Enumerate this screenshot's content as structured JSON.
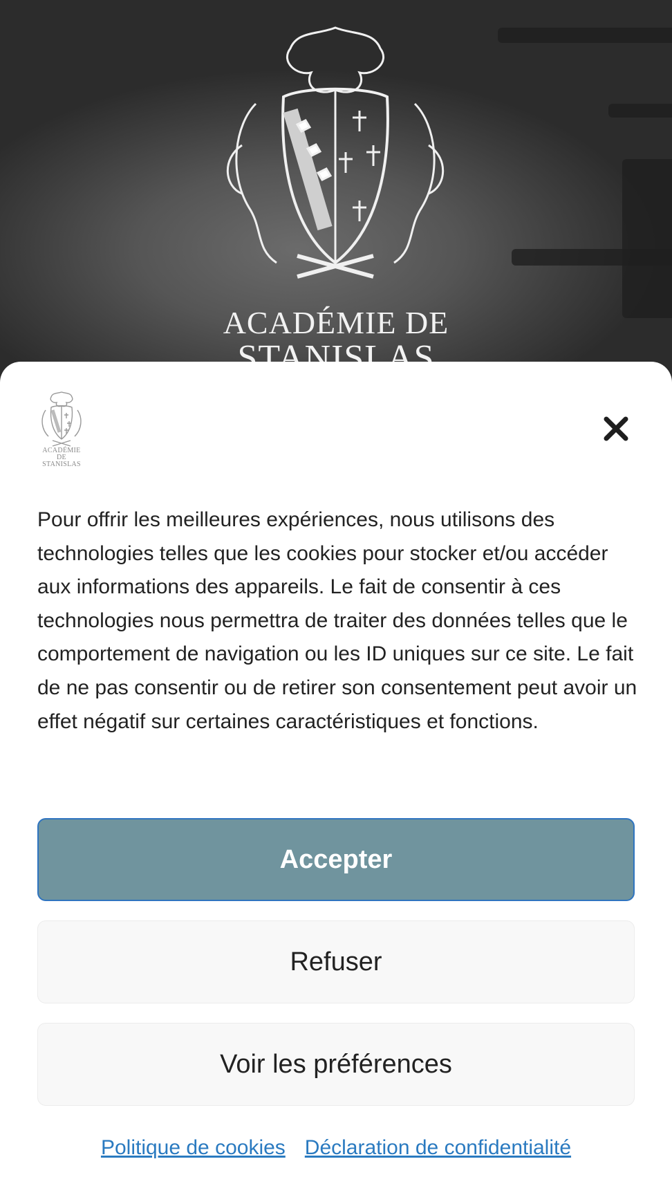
{
  "hero": {
    "title_line1": "ACADÉMIE DE",
    "title_line2": "STANISLAS",
    "crest_icon": "academie-crest-icon"
  },
  "consent": {
    "logo_text_line1": "ACADÉMIE DE",
    "logo_text_line2": "STANISLAS",
    "close_icon": "close-icon",
    "message": "Pour offrir les meilleures expériences, nous utilisons des technologies telles que les cookies pour stocker et/ou accéder aux informations des appareils. Le fait de consentir à ces technologies nous permettra de traiter des données telles que le comportement de navigation ou les ID uniques sur ce site. Le fait de ne pas consentir ou de retirer son consentement peut avoir un effet négatif sur certaines caractéristiques et fonctions.",
    "accept_label": "Accepter",
    "refuse_label": "Refuser",
    "preferences_label": "Voir les préférences",
    "links": {
      "cookie_policy": "Politique de cookies",
      "privacy_statement": "Déclaration de confidentialité"
    }
  },
  "colors": {
    "accept_bg": "#70949e",
    "accept_border": "#2f74c0",
    "link": "#2a7ac0",
    "secondary_bg": "#f8f8f8"
  }
}
